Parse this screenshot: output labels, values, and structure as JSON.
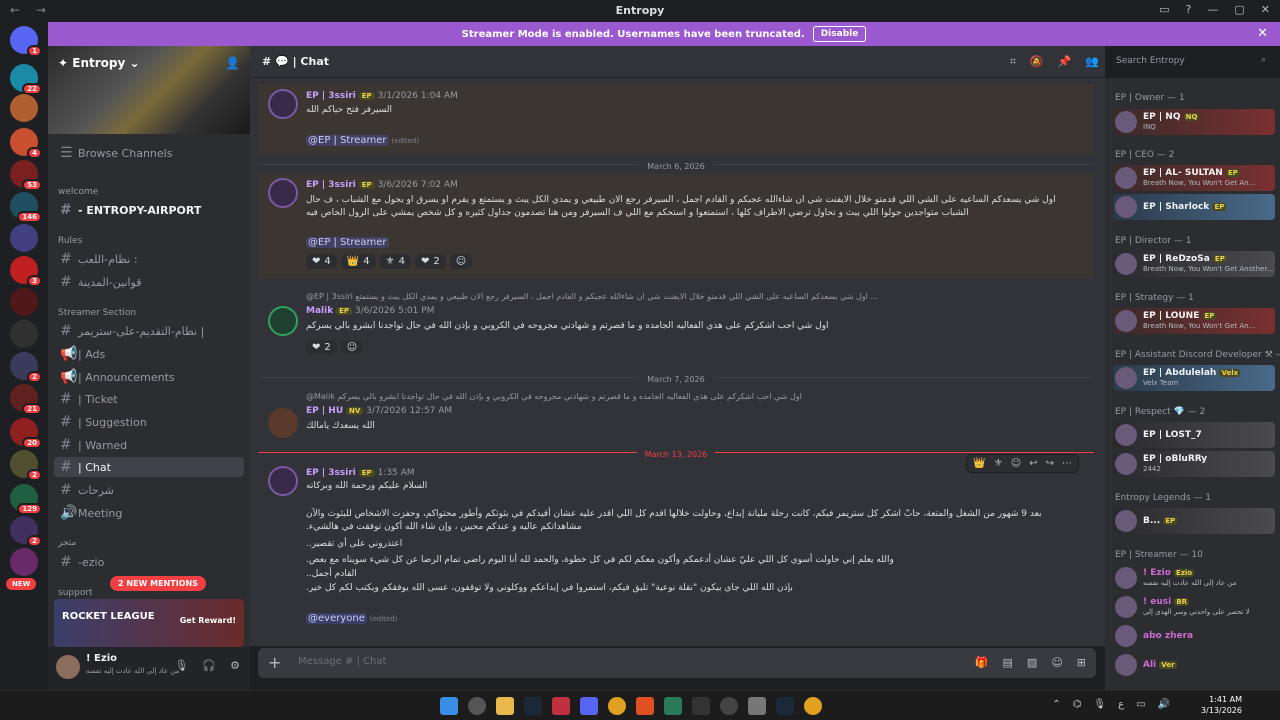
{
  "window": {
    "title": "Entropy"
  },
  "banner": {
    "text": "Streamer Mode is enabled. Usernames have been truncated.",
    "disable_label": "Disable"
  },
  "rail": {
    "badges": [
      "1",
      "22",
      "4",
      "53",
      "146",
      "3",
      "2",
      "21",
      "20",
      "2",
      "129",
      "2"
    ],
    "new_label": "NEW"
  },
  "sidebar": {
    "guild_name": "Entropy",
    "browse": "Browse Channels",
    "cat_welcome": "welcome",
    "airport": "- ENTROPY-AIRPORT",
    "cat_rules": "Rules",
    "rules1": "نظام-اللعب :",
    "rules2": "قوانين-المدينة",
    "cat_streamer": "Streamer Section",
    "streamer1": "نظام-التقديم-على-ستريمر |",
    "ads": "| Ads",
    "announcements": "| Announcements",
    "ticket": "| Ticket",
    "suggestion": "| Suggestion",
    "warned": "| Warned",
    "chat": "| Chat",
    "explain": "شرحات",
    "meeting": "Meeting",
    "cat_misc": "متجر",
    "ezio": "-ezio",
    "cat_support": "support",
    "new_mentions": "2 NEW MENTIONS",
    "promo_logo": "ROCKET LEAGUE",
    "promo_reward": "Get Reward!"
  },
  "user": {
    "name": "! Ezio",
    "status": "من عاد إلى الله عادت إليه نفسه"
  },
  "chat_header": {
    "channel": "| Chat",
    "search_placeholder": "Search Entropy"
  },
  "messages": {
    "m1": {
      "name": "EP | 3ssiri",
      "tag": "EP",
      "time": "3/1/2026 1:04 AM",
      "text": "السيرفر فتح حياكم الله",
      "mention": "@EP | Streamer",
      "edited": "(edited)"
    },
    "d1": "March 6, 2026",
    "m2": {
      "name": "EP | 3ssiri",
      "tag": "EP",
      "time": "3/6/2026 7:02 AM",
      "text": "اول شي يسعدكم الساعيه على الشي اللي قدمتو خلال الايفنت شي ان شاءالله عجبكم و القادم اجمل ، السيرفر رجع الان طبيعي و يمدي الكل يبث و يستمتع و يفرم او يسرق او يجول مع الشباب ، ف حال الشباب متواجدين جولوا اللي يبث و تحاول ترضي الاطراف كلها ، استمتعوا و استحكم مع اللي ف السيرفر ومن هنا تصدمون جداول كثيره و كل شخص يمشي على الرول الخاص فيه",
      "mention": "@EP | Streamer",
      "r1": "4",
      "r2": "4",
      "r3": "4",
      "r4": "2"
    },
    "m3": {
      "reply": "@EP | 3ssiri  اول شي يسعدكم الساعيه على الشي اللي قدمتو خلال الايفنت شي ان شاءالله عجبكم و القادم اجمل ، السيرفر رجع الان طبيعي و يمدي الكل يبث و يستمتع ...",
      "name": "Malik",
      "tag": "EP",
      "time": "3/6/2026 5:01 PM",
      "text": "اول شي احب اشكركم على هذي الفعاليه الجامده و ما قصرتم و شهادتي مجروحه في الكروبي و بإذن الله في حال تواجدنا ابشرو بالي يسركم",
      "r1": "2"
    },
    "d2": "March 7, 2026",
    "m4": {
      "reply": "@Malik  اول شي احب اشكركم على هذي الفعاليه الجامده و ما قصرتم و شهادتي مجروحه في الكروبي و بإذن الله في حال تواجدنا ابشرو بالي يسركم",
      "name": "EP | HU",
      "tag": "NV",
      "time": "3/7/2026 12:57 AM",
      "text": "الله يسعدك يامالك"
    },
    "d3": "March 13, 2026",
    "new_label": "NEW",
    "m5": {
      "name": "EP | 3ssiri",
      "tag": "EP",
      "time": "1:35 AM",
      "greet": "السلام عليكم ورحمة الله وبركاته",
      "p1": "بعد 9 شهور من الشغل والمتعة، حابّ اشكر كل ستريمر فيكم، كانت رحلة مليانة إبداع، وحاولت خلالها اقدم كل اللي اقدر عليه عشان أقيدكم في بثوثكم وأطور محتواكم، وحفزت الاشخاص للبثوث والآن مشاهداتكم عاليه و عندكم محبين ، وإن شاء الله أكون توفقت في هالشيء.",
      "p2": "اعتذروني على أي تقصير..",
      "p3": "والله يعلم إني حاولت أسوي كل اللي عليّ عشان أدعمكم وأكون معكم لكم في كل خطوة، والحمد لله أنا اليوم راضي تمام الرضا عن كل شيء سويناه مع بعض.",
      "p4": "القادم أجمل..",
      "p5": "بإذن الله اللي جاي بيكون \"نقلة نوعية\" تليق فيكم، استمروا في إبداعكم ووكلوني ولا توقفون، عسى الله يوفقكم ويكتب لكم كل خير.",
      "mention": "@everyone",
      "edited": "(edited)"
    }
  },
  "composer": {
    "placeholder": "Message #  | Chat"
  },
  "members": {
    "owner_cat": "EP | Owner — 1",
    "nq": {
      "name": "EP | NQ",
      "tag": "NQ",
      "status": "INQ"
    },
    "ceo_cat": "EP | CEO — 2",
    "sultan": {
      "name": "EP | AL- SULTAN",
      "tag": "EP",
      "status": "Breath Now, You Won't Get An..."
    },
    "sharlock": {
      "name": "EP | Sharlock",
      "tag": "EP"
    },
    "director_cat": "EP | Director — 1",
    "redzosa": {
      "name": "EP | ReDzoSa",
      "tag": "EP",
      "status": "Breath Now, You Won't Get Another..."
    },
    "strategy_cat": "EP | Strategy — 1",
    "loune": {
      "name": "EP | LOUNE",
      "tag": "EP",
      "status": "Breath Now, You Won't Get An..."
    },
    "assistant_cat": "EP | Assistant Discord Developer ⚒ — 1",
    "abdulelah": {
      "name": "EP | Abdulelah",
      "tag": "Velx",
      "status": "Velx Team"
    },
    "respect_cat": "EP | Respect 💎 — 2",
    "lost": {
      "name": "EP | LOST_7"
    },
    "oblurry": {
      "name": "EP | oBluRRy",
      "status": "2442"
    },
    "legends_cat": "Entropy Legends — 1",
    "b": {
      "name": "B...",
      "tag": "EP"
    },
    "streamer_cat": "EP | Streamer — 10",
    "ezio": {
      "name": "! Ezio",
      "tag": "Ezio",
      "status": "من عاد إلى الله عادت إليه نفسه"
    },
    "eusi": {
      "name": "! eusi",
      "tag": "BR",
      "status": "لا تحصر على واحدتي وسر الهدى إلى"
    },
    "abo": {
      "name": "abo zhera"
    },
    "ali": {
      "name": "Ali",
      "tag": "Ver"
    }
  },
  "taskbar": {
    "time": "1:41 AM",
    "date": "3/13/2026"
  }
}
